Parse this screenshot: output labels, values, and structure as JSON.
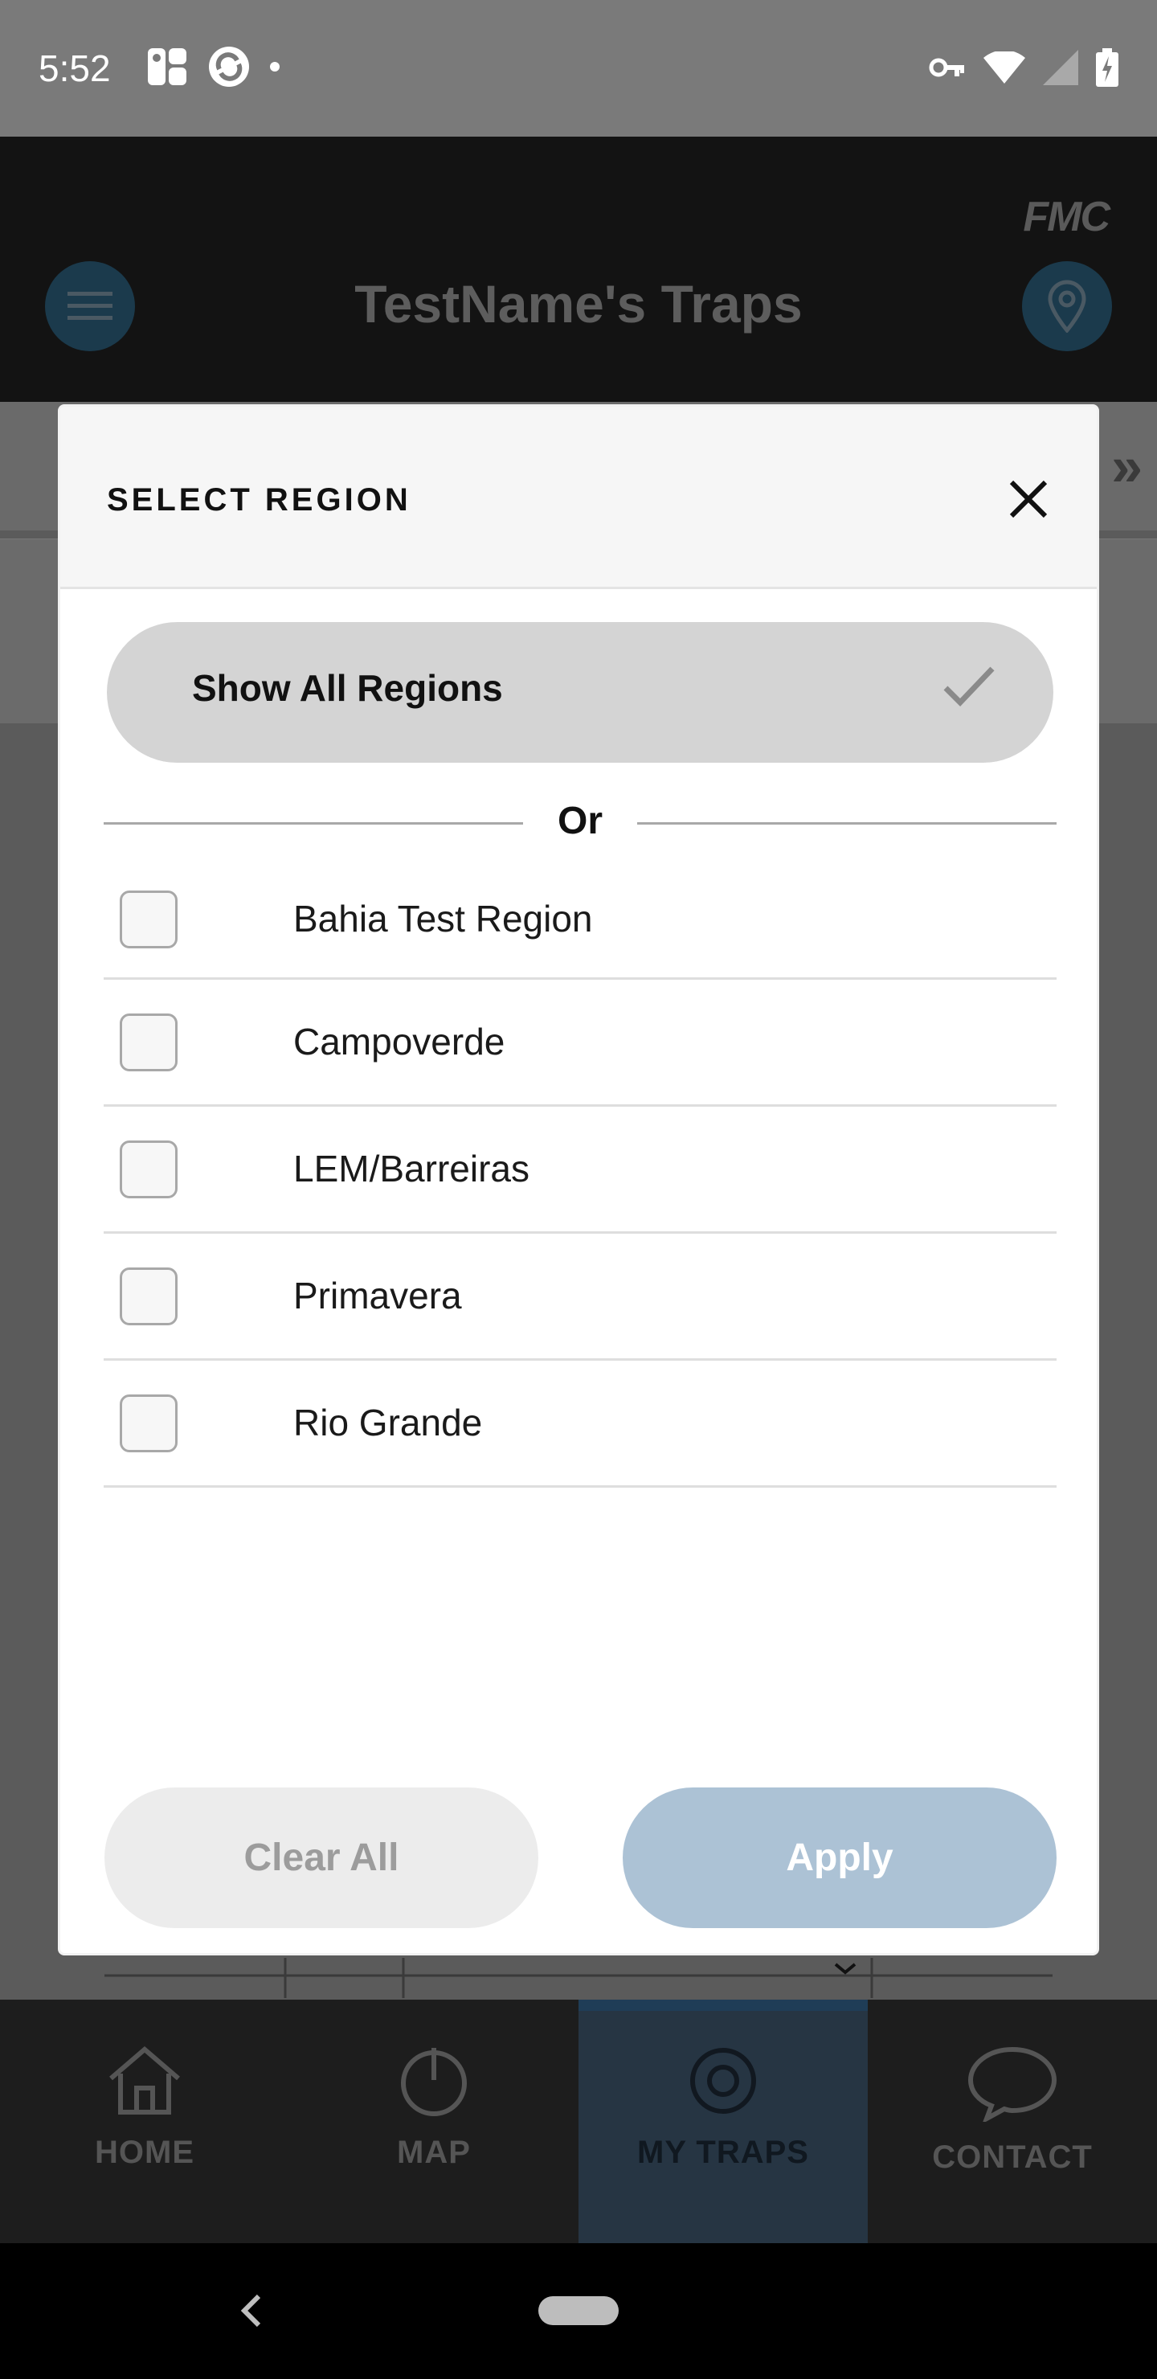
{
  "status_bar": {
    "time": "5:52"
  },
  "header": {
    "brand": "FMC",
    "title": "TestName's Traps"
  },
  "modal": {
    "title": "SELECT REGION",
    "show_all_label": "Show All Regions",
    "divider_text": "Or",
    "regions": [
      {
        "label": "Bahia Test Region",
        "checked": false
      },
      {
        "label": "Campoverde",
        "checked": false
      },
      {
        "label": "LEM/Barreiras",
        "checked": false
      },
      {
        "label": "Primavera",
        "checked": false
      },
      {
        "label": "Rio Grande",
        "checked": false
      }
    ],
    "clear_label": "Clear All",
    "apply_label": "Apply"
  },
  "bottom_nav": {
    "items": [
      {
        "label": "HOME",
        "icon": "home-icon",
        "active": false
      },
      {
        "label": "MAP",
        "icon": "map-icon",
        "active": false
      },
      {
        "label": "MY TRAPS",
        "icon": "target-icon",
        "active": true
      },
      {
        "label": "CONTACT",
        "icon": "chat-icon",
        "active": false
      }
    ]
  },
  "colors": {
    "accent_blue": "#acc2d5",
    "header_bg": "#131313",
    "status_bar": "#7a7a7a",
    "chip_gray": "#d4d4d4"
  }
}
